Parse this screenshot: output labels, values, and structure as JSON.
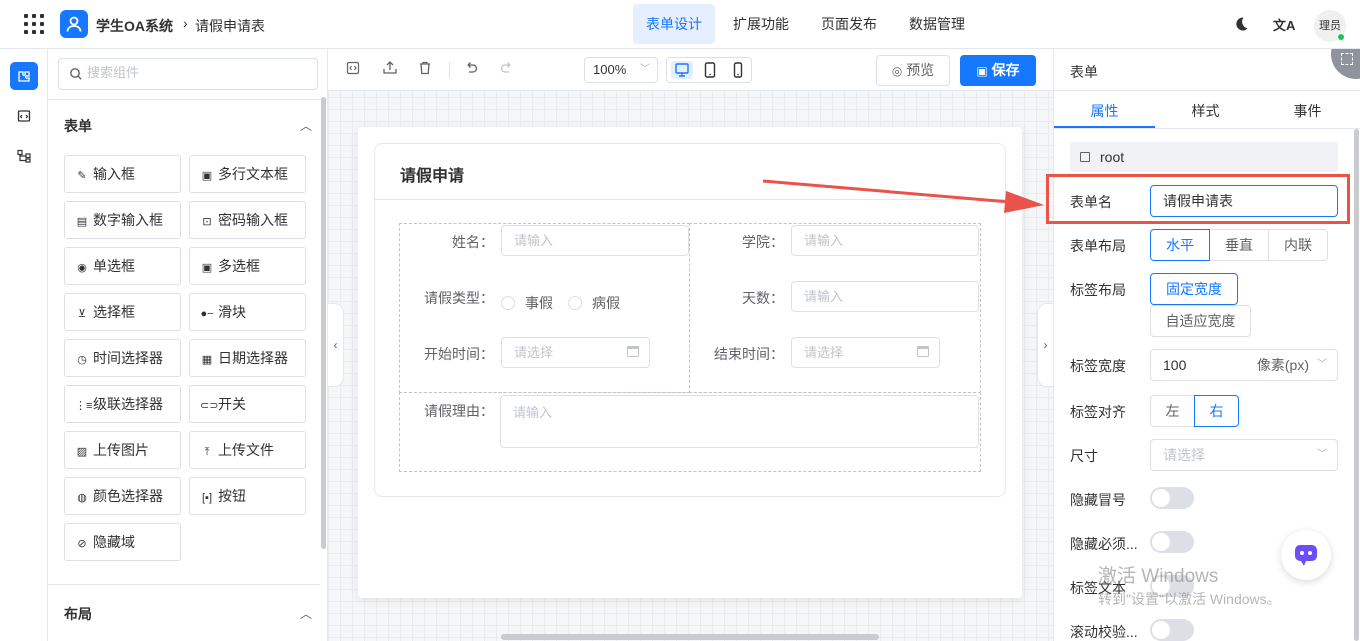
{
  "header": {
    "app_title": "学生OA系统",
    "breadcrumb_sep": "›",
    "breadcrumb": "请假申请表",
    "tabs": [
      "表单设计",
      "扩展功能",
      "页面发布",
      "数据管理"
    ],
    "avatar_label": "理员"
  },
  "components": {
    "search_placeholder": "搜索组件",
    "form_section": "表单",
    "form_items": [
      "输入框",
      "多行文本框",
      "数字输入框",
      "密码输入框",
      "单选框",
      "多选框",
      "选择框",
      "滑块",
      "时间选择器",
      "日期选择器",
      "级联选择器",
      "开关",
      "上传图片",
      "上传文件",
      "颜色选择器",
      "按钮",
      "隐藏域"
    ],
    "layout_section": "布局"
  },
  "toolbar": {
    "zoom": "100%",
    "preview_label": "预览",
    "save_label": "保存"
  },
  "form": {
    "title": "请假申请",
    "fields": {
      "name_label": "姓名：",
      "name_placeholder": "请输入",
      "college_label": "学院：",
      "college_placeholder": "请输入",
      "type_label": "请假类型：",
      "type_options": [
        "事假",
        "病假"
      ],
      "days_label": "天数：",
      "days_placeholder": "请输入",
      "start_label": "开始时间：",
      "start_placeholder": "请选择",
      "end_label": "结束时间：",
      "end_placeholder": "请选择",
      "reason_label": "请假理由：",
      "reason_placeholder": "请输入"
    }
  },
  "props": {
    "panel_title": "表单",
    "tabs": [
      "属性",
      "样式",
      "事件"
    ],
    "root_label": "root",
    "form_name_label": "表单名",
    "form_name_value": "请假申请表",
    "form_layout_label": "表单布局",
    "form_layout_options": [
      "水平",
      "垂直",
      "内联"
    ],
    "label_layout_label": "标签布局",
    "label_layout_options": [
      "固定宽度",
      "自适应宽度"
    ],
    "label_width_label": "标签宽度",
    "label_width_value": "100",
    "label_width_unit": "像素(px)",
    "label_align_label": "标签对齐",
    "label_align_options": [
      "左",
      "右"
    ],
    "size_label": "尺寸",
    "size_placeholder": "请选择",
    "hide_colon_label": "隐藏冒号",
    "hide_required_label": "隐藏必须...",
    "label_text_label": "标签文本",
    "scroll_validate_label": "滚动校验..."
  },
  "watermark": {
    "line1": "激活 Windows",
    "line2": "转到\"设置\"以激活 Windows。"
  },
  "colors": {
    "accent": "#1677ff",
    "annotation": "#e8534a"
  }
}
